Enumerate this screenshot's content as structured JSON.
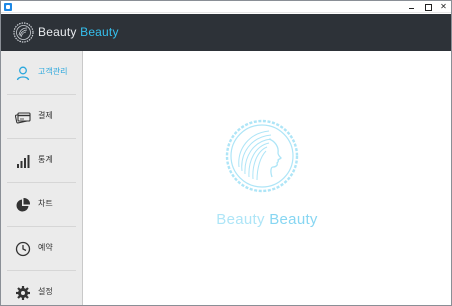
{
  "window": {
    "controls": {
      "minimize": "minimize",
      "maximize": "maximize",
      "close": "✕"
    }
  },
  "header": {
    "title_part1": "Beauty",
    "title_part2": "Beauty",
    "accent_color": "#35c0ee",
    "background": "#2d3238"
  },
  "sidebar": {
    "items": [
      {
        "label": "고객관리",
        "icon": "user-icon",
        "active": true
      },
      {
        "label": "결제",
        "icon": "credit-card-icon",
        "active": false
      },
      {
        "label": "통계",
        "icon": "bar-chart-icon",
        "active": false
      },
      {
        "label": "차트",
        "icon": "pie-chart-icon",
        "active": false
      },
      {
        "label": "예약",
        "icon": "clock-icon",
        "active": false
      },
      {
        "label": "설정",
        "icon": "gear-icon",
        "active": false
      }
    ]
  },
  "main": {
    "splash_part1": "Beauty",
    "splash_part2": "Beauty",
    "emblem_icon": "woman-profile-logo-icon"
  }
}
